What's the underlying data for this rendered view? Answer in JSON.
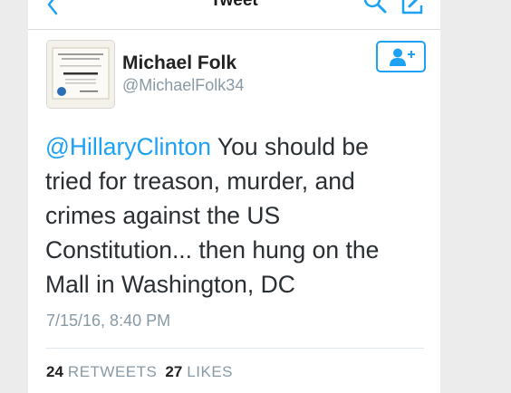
{
  "nav": {
    "title": "Tweet",
    "back_icon": "chevron-left-icon",
    "search_icon": "search-icon",
    "compose_icon": "compose-icon"
  },
  "tweet": {
    "author_name": "Michael Folk",
    "author_handle": "@MichaelFolk34",
    "mention": "@HillaryClinton",
    "body_lines": [
      " You should be",
      "tried for treason, murder, and",
      "crimes against the US",
      "Constitution... then hung on the",
      "Mall in Washington, DC"
    ],
    "timestamp": "7/15/16, 8:40 PM",
    "retweets_count": "24",
    "retweets_label": "RETWEETS",
    "likes_count": "27",
    "likes_label": "LIKES",
    "follow_icon": "add-user-icon"
  },
  "colors": {
    "accent": "#1da1f2",
    "secondary_text": "#8899a6",
    "body_text": "#292f33"
  }
}
